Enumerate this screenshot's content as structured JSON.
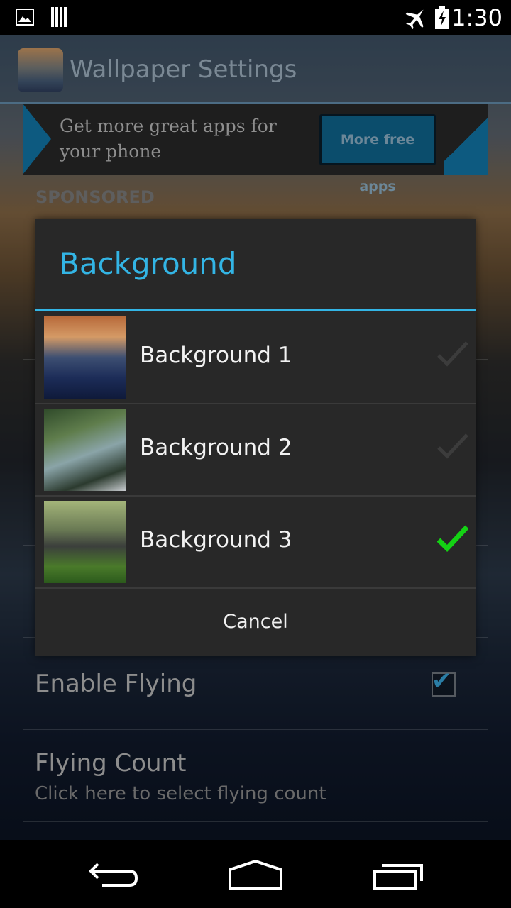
{
  "status_bar": {
    "time": "1:30",
    "icons": [
      "image-icon",
      "barcode-icon",
      "airplane-icon",
      "battery-charging-icon"
    ]
  },
  "action_bar": {
    "title": "Wallpaper Settings"
  },
  "ad": {
    "text": "Get more great apps for your phone",
    "button_label": "More free apps",
    "sponsored_label": "SPONSORED"
  },
  "settings": {
    "enable_flying": {
      "title": "Enable Flying",
      "checked": true
    },
    "flying_count": {
      "title": "Flying Count",
      "summary": "Click here to select flying count"
    }
  },
  "dialog": {
    "title": "Background",
    "options": [
      {
        "label": "Background 1",
        "selected": false
      },
      {
        "label": "Background 2",
        "selected": false
      },
      {
        "label": "Background 3",
        "selected": true
      }
    ],
    "cancel_label": "Cancel"
  },
  "colors": {
    "accent": "#33b5e5",
    "check_selected": "#14d214",
    "check_unselected": "#3c3c3c"
  },
  "nav_bar": {
    "buttons": [
      "back-icon",
      "home-icon",
      "recent-apps-icon"
    ]
  }
}
